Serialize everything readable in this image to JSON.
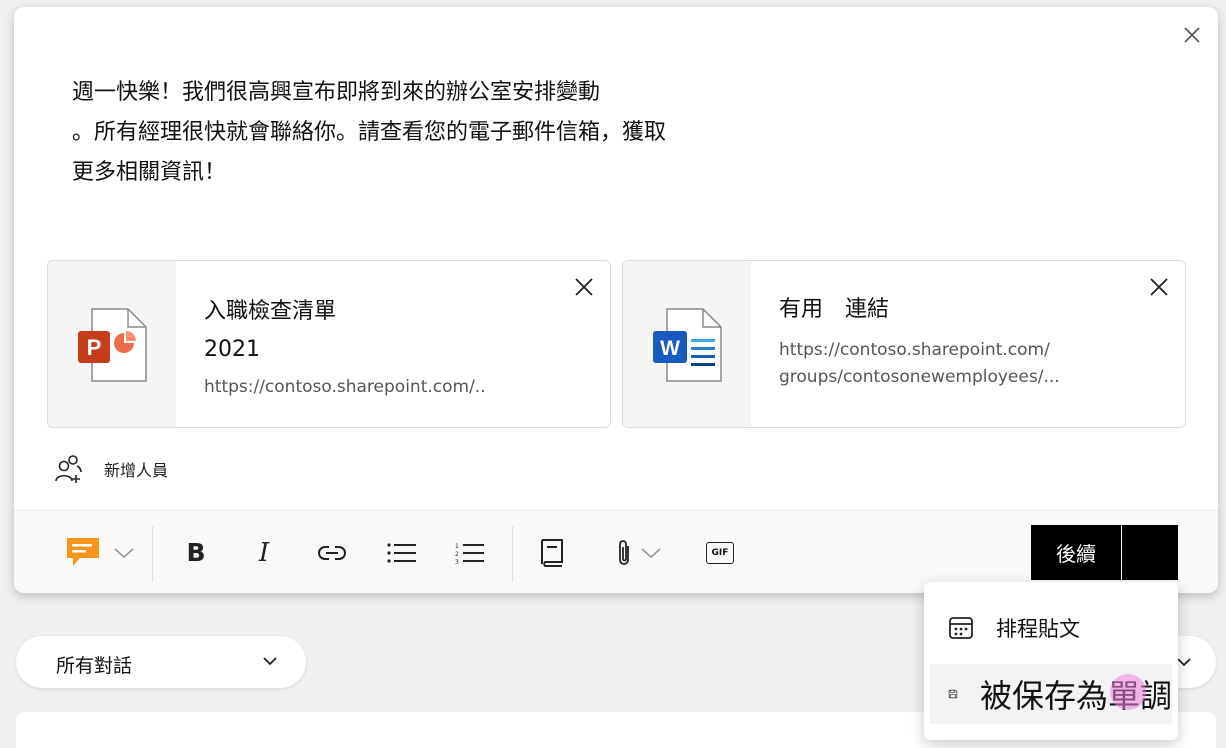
{
  "composer": {
    "message_lines": [
      "週一快樂！我們很高興宣布即將到來的辦公室安排變動",
      "。所有經理很快就會聯絡你。請查看您的電子郵件信箱，獲取",
      "更多相關資訊！"
    ],
    "attachments": [
      {
        "type": "powerpoint",
        "title": "入職檢查清單",
        "subtitle": "2021",
        "url_lines": [
          "https://contoso.sharepoint.com/.."
        ]
      },
      {
        "type": "word",
        "title": "有用　連結",
        "subtitle": "",
        "url_lines": [
          "https://contoso.sharepoint.com/",
          "groups/contosonewemployees/..."
        ]
      }
    ],
    "add_people_label": "新增人員"
  },
  "toolbar": {
    "icons": [
      "message-type-icon",
      "bold-icon",
      "italic-icon",
      "link-icon",
      "bullet-list-icon",
      "numbered-list-icon",
      "knowledge-icon",
      "attach-icon",
      "gif-icon"
    ],
    "gif_label": "GIF",
    "bold_label": "B",
    "italic_label": "I",
    "send_label": "後續"
  },
  "send_menu": {
    "items": [
      {
        "label": "排程貼文",
        "icon": "calendar-icon"
      },
      {
        "label": "被保存為單調",
        "icon": "save-icon"
      }
    ]
  },
  "feed": {
    "filter_label": "所有對話"
  },
  "colors": {
    "accent_orange": "#f7941d",
    "ppt_red": "#c43e1c",
    "word_blue": "#185abd",
    "send_button": "#000000"
  }
}
